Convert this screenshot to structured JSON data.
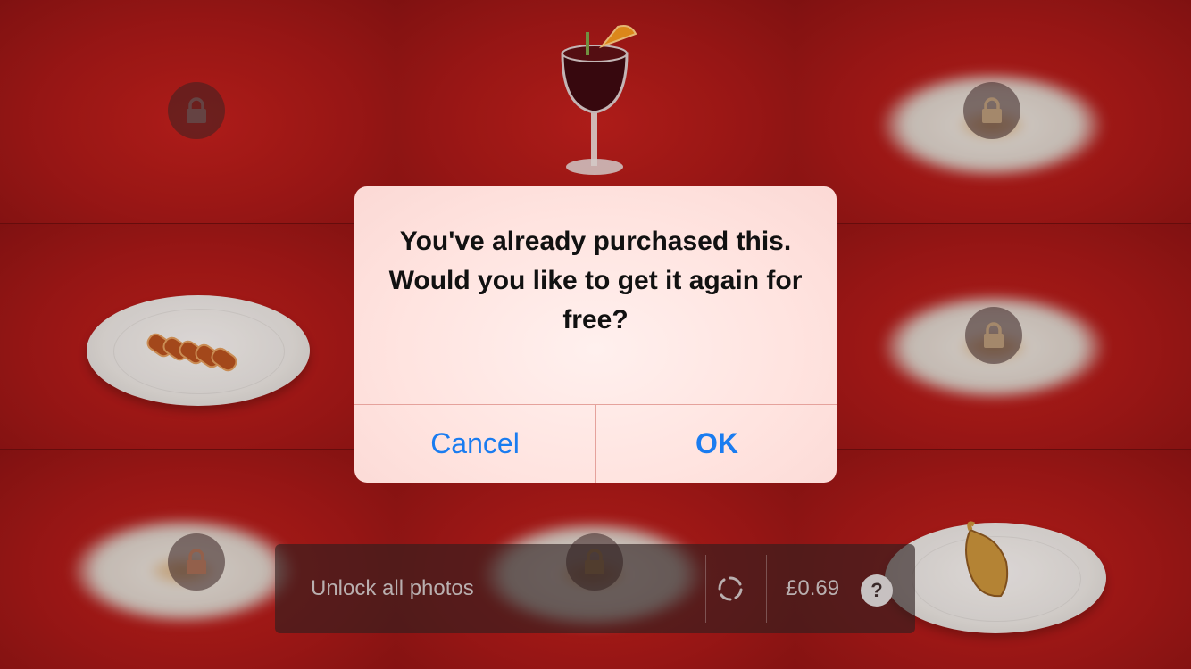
{
  "alert": {
    "message": "You've already purchased this. Would you like to get it again for free?",
    "cancel_label": "Cancel",
    "ok_label": "OK"
  },
  "purchase_bar": {
    "label": "Unlock all photos",
    "price": "£0.69",
    "help_label": "?"
  },
  "icons": {
    "lock": "lock-icon",
    "spinner": "loading-spinner-icon",
    "help": "question-mark-icon"
  },
  "colors": {
    "accent": "#1a7cf0",
    "background_red": "#a71a18",
    "alert_background": "#ffe3df"
  }
}
